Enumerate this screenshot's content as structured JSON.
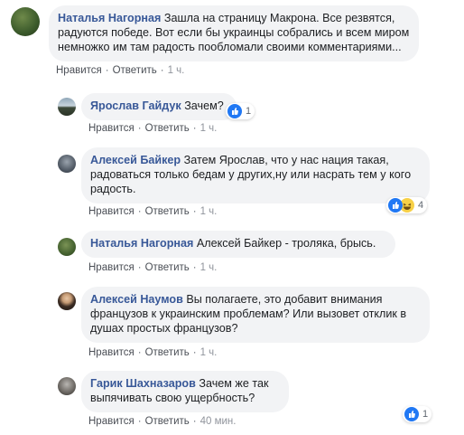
{
  "comments": [
    {
      "author": "Наталья Нагорная",
      "text": "Зашла на страницу Макрона. Все резвятся, радуются победе. Вот если бы украинцы собрались и всем миром немножко им там радость пообломали своими комментариями...",
      "like": "Нравится",
      "reply": "Ответить",
      "time": "1 ч."
    },
    {
      "author": "Ярослав Гайдук",
      "text": "Зачем?",
      "like": "Нравится",
      "reply": "Ответить",
      "time": "1 ч.",
      "reaction_count": "1"
    },
    {
      "author": "Алексей Байкер",
      "text": "Затем Ярослав, что у нас нация такая, радоваться только бедам у других,ну или насрать тем у кого радость.",
      "like": "Нравится",
      "reply": "Ответить",
      "time": "1 ч.",
      "reaction_count": "4"
    },
    {
      "author": "Наталья Нагорная",
      "text": "Алексей Байкер - троляка, брысь.",
      "like": "Нравится",
      "reply": "Ответить",
      "time": "1 ч."
    },
    {
      "author": "Алексей Наумов",
      "text": "Вы полагаете, это добавит внимания французов к украинским проблемам? Или вызовет отклик в душах простых французов?",
      "like": "Нравится",
      "reply": "Ответить",
      "time": "1 ч."
    },
    {
      "author": "Гарик Шахназаров",
      "text": "Зачем же так выпячивать свою ущербность?",
      "like": "Нравится",
      "reply": "Ответить",
      "time": "40 мин.",
      "reaction_count": "1"
    }
  ],
  "colors": {
    "link": "#385898",
    "bubble": "#f2f3f5",
    "like_blue": "#2078f4",
    "haha_yellow": "#f7d046"
  },
  "icons": [
    "like-icon",
    "haha-icon"
  ]
}
